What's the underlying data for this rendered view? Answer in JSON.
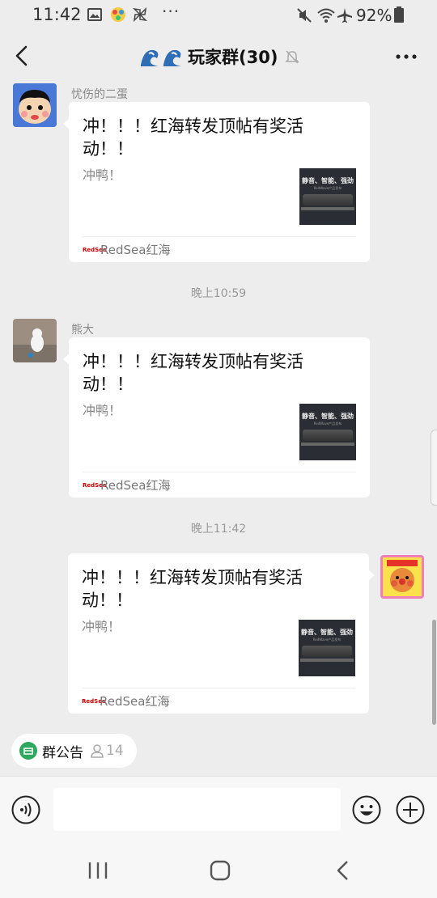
{
  "status_bar": {
    "time": "11:42",
    "more": "···",
    "battery": "92%"
  },
  "nav": {
    "title": "玩家群(30)"
  },
  "messages": [
    {
      "sender": "忧伤的二蛋",
      "title": "冲！！！红海转发顶帖有奖活动！！",
      "desc": "冲鸭！",
      "thumb_text": "静音、智能、强劲",
      "thumb_sub": "RedWave产品发布",
      "source": "RedSea红海",
      "source_logo": "RedSea"
    },
    {
      "sender": "熊大",
      "title": "冲！！！红海转发顶帖有奖活动！！",
      "desc": "冲鸭！",
      "thumb_text": "静音、智能、强劲",
      "thumb_sub": "RedWave产品发布",
      "source": "RedSea红海",
      "source_logo": "RedSea"
    },
    {
      "sender": "",
      "title": "冲！！！红海转发顶帖有奖活动！！",
      "desc": "冲鸭！",
      "thumb_text": "静音、智能、强劲",
      "thumb_sub": "RedWave产品发布",
      "source": "RedSea红海",
      "source_logo": "RedSea"
    }
  ],
  "timestamps": [
    "晚上10:59",
    "晚上11:42"
  ],
  "group_bar": {
    "notice_label": "群公告",
    "member_count": "14"
  },
  "input": {
    "value": "",
    "placeholder": ""
  },
  "colors": {
    "background": "#ededed",
    "card": "#ffffff",
    "accent_green": "#2ea85e",
    "secondary_text": "#888888"
  },
  "icons": {
    "status_left": [
      "gallery-icon",
      "app-icon",
      "pinwheel-icon"
    ],
    "status_right": [
      "mute-icon",
      "wifi-icon",
      "airplane-icon",
      "battery-icon"
    ],
    "nav": [
      "back-chevron-icon",
      "wave-emoji-icon",
      "muted-bell-icon",
      "more-dots-icon"
    ],
    "input": [
      "voice-icon",
      "emoji-icon",
      "plus-icon"
    ],
    "system": [
      "recents-icon",
      "home-icon",
      "back-icon"
    ]
  }
}
